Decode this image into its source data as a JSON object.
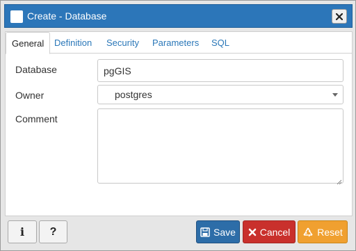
{
  "window": {
    "title": "Create - Database"
  },
  "tabs": [
    {
      "label": "General",
      "active": true
    },
    {
      "label": "Definition",
      "active": false
    },
    {
      "label": "Security",
      "active": false
    },
    {
      "label": "Parameters",
      "active": false
    },
    {
      "label": "SQL",
      "active": false
    }
  ],
  "form": {
    "database": {
      "label": "Database",
      "value": "pgGIS"
    },
    "owner": {
      "label": "Owner",
      "value": "postgres"
    },
    "comment": {
      "label": "Comment",
      "value": ""
    }
  },
  "footer": {
    "info_label": "i",
    "help_label": "?",
    "save_label": "Save",
    "cancel_label": "Cancel",
    "reset_label": "Reset"
  },
  "colors": {
    "titlebar": "#2c76b9",
    "save": "#2d6da8",
    "cancel": "#c9302c",
    "reset": "#f0a030",
    "tab_link": "#2a77b8"
  },
  "icons": {
    "close": "close-icon",
    "save": "floppy-disk-icon",
    "cancel": "x-icon",
    "reset": "recycle-icon",
    "select_caret": "caret-down-icon"
  }
}
